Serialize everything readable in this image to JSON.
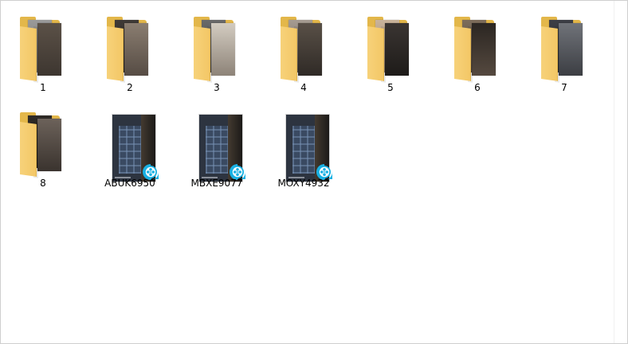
{
  "folders": [
    {
      "label": "1",
      "colors": [
        "#8e8e8e",
        "#5b5147"
      ]
    },
    {
      "label": "2",
      "colors": [
        "#4a4540",
        "#8a7d70"
      ]
    },
    {
      "label": "3",
      "colors": [
        "#6a6a6a",
        "#c7c0b4"
      ]
    },
    {
      "label": "4",
      "colors": [
        "#595047",
        "#9b9591"
      ]
    },
    {
      "label": "5",
      "colors": [
        "#b9a48f",
        "#2e2a28"
      ]
    },
    {
      "label": "6",
      "colors": [
        "#6b5d4d",
        "#2b2622"
      ]
    },
    {
      "label": "7",
      "colors": [
        "#3d3f46",
        "#707379"
      ]
    },
    {
      "label": "8",
      "colors": [
        "#2e2a26",
        "#6c625a"
      ]
    }
  ],
  "videos": [
    {
      "label": "ABUK6950"
    },
    {
      "label": "MBXE9077"
    },
    {
      "label": "MOXY4932"
    }
  ],
  "colors": {
    "folder": "#e3b74a",
    "folder_front": "#f7d27a",
    "badge": "#19b1e3"
  }
}
